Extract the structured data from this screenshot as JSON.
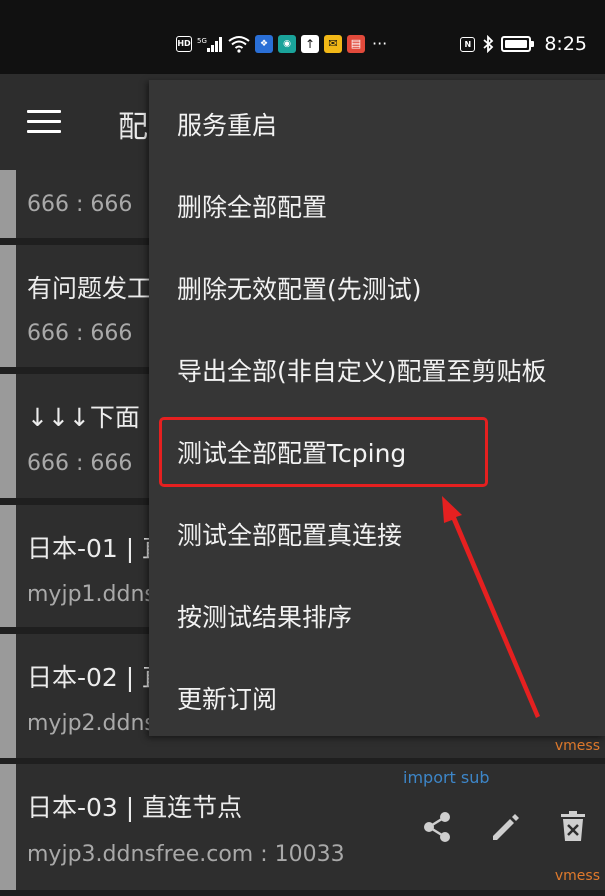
{
  "status_bar": {
    "time": "8:25",
    "icons": [
      "hd-icon",
      "5g-signal-icon",
      "wifi-icon",
      "app-notification-icon",
      "app-notification-icon",
      "upload-icon",
      "mail-icon",
      "book-icon",
      "more-dots-icon",
      "nfc-icon",
      "bluetooth-icon",
      "battery-icon"
    ],
    "hd_label": "HD",
    "more": "···",
    "nfc_label": "N"
  },
  "app_bar": {
    "title": "配"
  },
  "configs": [
    {
      "name": "",
      "address": "666 : 666",
      "type": ""
    },
    {
      "name": "有问题发工",
      "address": "666 : 666",
      "type": ""
    },
    {
      "name": "↓↓↓下面",
      "address": "666 : 666",
      "type": ""
    },
    {
      "name": "日本-01 | 直",
      "address": "myjp1.ddns",
      "type": ""
    },
    {
      "name": "日本-02 | 直",
      "address": "myjp2.ddns",
      "type": "vmess"
    },
    {
      "name": "日本-03 | 直连节点",
      "address": "myjp3.ddnsfree.com : 10033",
      "type": "vmess"
    }
  ],
  "import_sub": "import sub",
  "menu": {
    "items": [
      "服务重启",
      "删除全部配置",
      "删除无效配置(先测试)",
      "导出全部(非自定义)配置至剪贴板",
      "测试全部配置Tcping",
      "测试全部配置真连接",
      "按测试结果排序",
      "更新订阅"
    ],
    "highlighted_index": 4
  },
  "colors": {
    "highlight": "#e52020",
    "accent_orange": "#e07a2c",
    "link_blue": "#3d86c8"
  }
}
